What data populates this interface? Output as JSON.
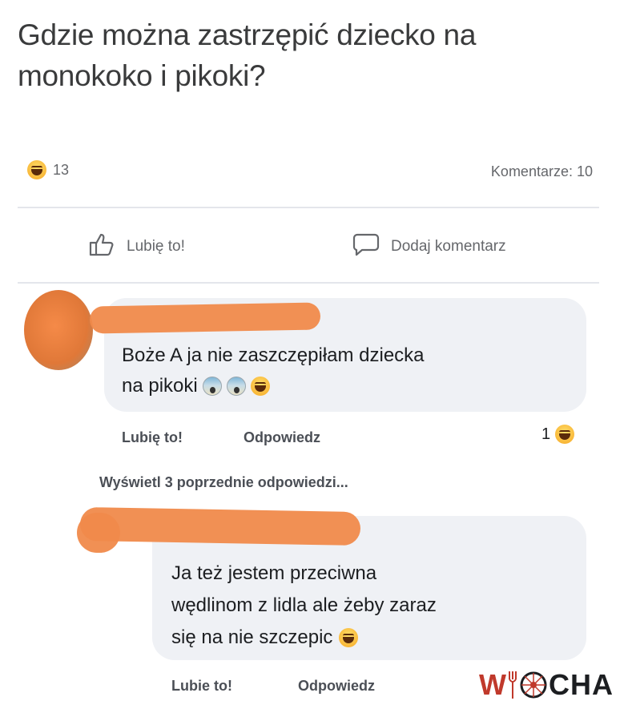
{
  "post": {
    "text": "Gdzie można zastrzępić dziecko na monokoko i pikoki?"
  },
  "stats": {
    "reaction_icon": "laughing-emoji",
    "reaction_count": "13",
    "comments_label": "Komentarze: 10"
  },
  "actions": {
    "like_label": "Lubię to!",
    "comment_label": "Dodaj komentarz"
  },
  "comments": [
    {
      "author": "",
      "text_line1": "Boże A ja nie zaszczępiłam dziecka",
      "text_line2": "na pikoki",
      "emojis": [
        "fearful-emoji",
        "fearful-emoji",
        "laughing-emoji"
      ],
      "like_label": "Lubię to!",
      "reply_label": "Odpowiedz",
      "reaction_count": "1"
    },
    {
      "author": "",
      "text_line1": "Ja też jestem przeciwna",
      "text_line2": "wędlinom z lidla ale żeby zaraz",
      "text_line3": "się na nie szczepic",
      "emojis": [
        "laughing-emoji"
      ],
      "like_label": "Lubie to!",
      "reply_label": "Odpowiedz"
    }
  ],
  "view_replies": "Wyświetl 3 poprzednie odpowiedzi...",
  "watermark": {
    "text_w": "W",
    "text_rest": "CHA",
    "color_w": "#c0392b",
    "color_rest": "#1c1e21"
  },
  "colors": {
    "redaction": "#f08a4b",
    "bubble": "#eff1f5",
    "secondary_text": "#65676b"
  }
}
